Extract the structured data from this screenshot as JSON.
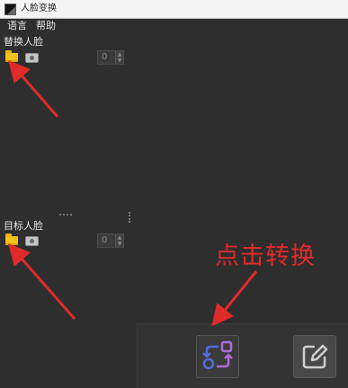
{
  "window": {
    "title": "人脸变换"
  },
  "menu": {
    "items": [
      {
        "label": "语言"
      },
      {
        "label": "帮助"
      }
    ]
  },
  "sections": {
    "replace_face": {
      "title": "替换人脸",
      "spin_value": "0"
    },
    "target_face": {
      "title": "目标人脸",
      "spin_value": "0"
    }
  },
  "annotation": {
    "text": "点击转换",
    "color": "#e02a2a"
  },
  "icons": {
    "folder": "folder-icon",
    "camera": "camera-icon",
    "convert": "swap-convert-icon",
    "edit": "edit-icon"
  },
  "colors": {
    "background": "#2e2e2e",
    "convert_blue": "#4f6dde",
    "convert_purple": "#b06ad9",
    "folder_yellow": "#f3c21a"
  }
}
